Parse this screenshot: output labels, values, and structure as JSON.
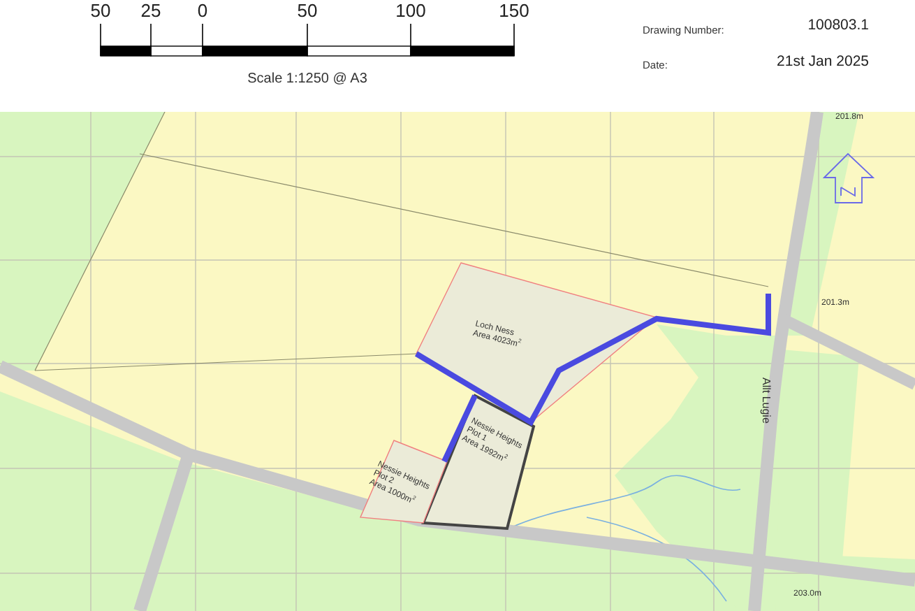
{
  "scale_bar": {
    "labels": [
      "50",
      "25",
      "0",
      "50",
      "100",
      "150"
    ],
    "caption": "Scale 1:1250 @ A3"
  },
  "info": [
    {
      "label": "Drawing Number:",
      "value": "100803.1"
    },
    {
      "label": "Date:",
      "value": "21st Jan 2025"
    }
  ],
  "map": {
    "heights": [
      "201.8m",
      "201.3m",
      "203.0m"
    ],
    "road_name": "Allt Lugie",
    "plots": [
      {
        "lines": [
          "Loch Ness",
          "Area 4023m$^{2}$"
        ]
      },
      {
        "lines": [
          "Nessie Heights",
          "Plot 1",
          "Area 1992m$^{2}$"
        ]
      },
      {
        "lines": [
          "Nessie Heights",
          "Plot 2",
          "Area 1000m$^{2}$"
        ]
      }
    ]
  }
}
